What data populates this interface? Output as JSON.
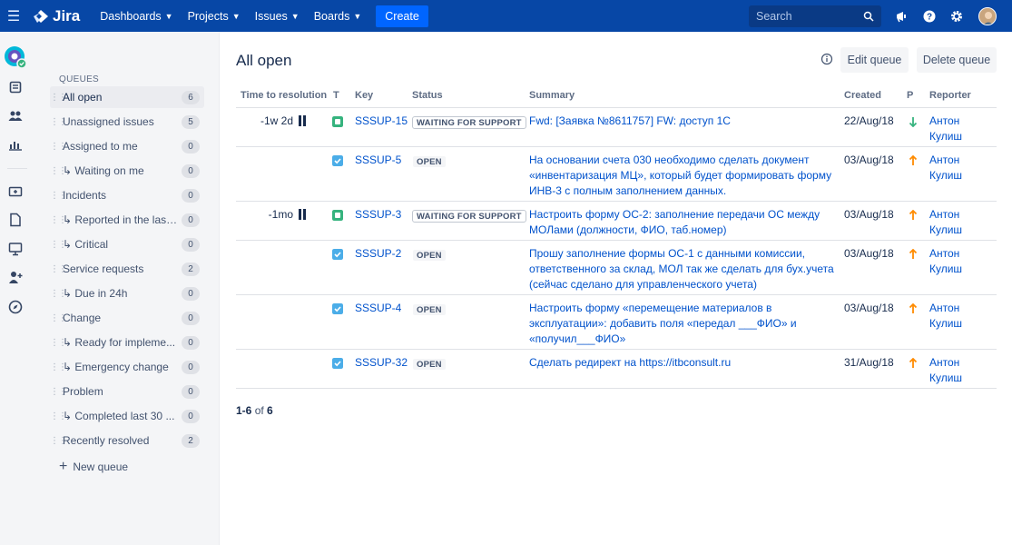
{
  "nav": {
    "brand": "Jira",
    "items": [
      {
        "label": "Dashboards"
      },
      {
        "label": "Projects"
      },
      {
        "label": "Issues"
      },
      {
        "label": "Boards"
      }
    ],
    "create_label": "Create",
    "search_placeholder": "Search",
    "icons": [
      "menu-icon",
      "jira-logo-icon",
      "search-icon",
      "notifications-icon",
      "help-icon",
      "settings-icon",
      "avatar"
    ]
  },
  "rail": {
    "icons": [
      "project-avatar",
      "queues-icon",
      "customers-icon",
      "reports-icon",
      "raise-request-icon",
      "knowledge-base-icon",
      "channels-icon",
      "invite-team-icon",
      "explore-icon"
    ]
  },
  "queues": {
    "title": "QUEUES",
    "items": [
      {
        "label": "All open",
        "count": "6"
      },
      {
        "label": "Unassigned issues",
        "count": "5"
      },
      {
        "label": "Assigned to me",
        "count": "0"
      },
      {
        "label": "↳ Waiting on me",
        "count": "0"
      },
      {
        "label": "Incidents",
        "count": "0"
      },
      {
        "label": "↳ Reported in the last...",
        "count": "0"
      },
      {
        "label": "↳ Critical",
        "count": "0"
      },
      {
        "label": "Service requests",
        "count": "2"
      },
      {
        "label": "↳ Due in 24h",
        "count": "0"
      },
      {
        "label": "Change",
        "count": "0"
      },
      {
        "label": "↳ Ready for impleme...",
        "count": "0"
      },
      {
        "label": "↳ Emergency change",
        "count": "0"
      },
      {
        "label": "Problem",
        "count": "0"
      },
      {
        "label": "↳ Completed last 30 ...",
        "count": "0"
      },
      {
        "label": "Recently resolved",
        "count": "2"
      }
    ],
    "new_queue_label": "New queue"
  },
  "main": {
    "title": "All open",
    "edit_queue_label": "Edit queue",
    "delete_queue_label": "Delete queue",
    "columns": [
      "Time to resolution",
      "T",
      "Key",
      "Status",
      "Summary",
      "Created",
      "P",
      "Reporter"
    ],
    "rows": [
      {
        "time": "-1w 2d",
        "paused": true,
        "type": "support",
        "key": "SSSUP-15",
        "status": "WAITING FOR SUPPORT",
        "summary": [
          "Fwd: [Заявка №8611757] FW: доступ 1С"
        ],
        "created": "22/Aug/18",
        "priority": "low",
        "reporter": [
          "Антон",
          "Кулиш"
        ]
      },
      {
        "time": "",
        "paused": false,
        "type": "task",
        "key": "SSSUP-5",
        "status": "OPEN",
        "summary": [
          "На основании счета 030 необходимо сделать документ",
          "«инвентаризация МЦ», который будет формировать форму",
          "ИНВ-3 с полным заполнением данных."
        ],
        "created": "03/Aug/18",
        "priority": "high",
        "reporter": [
          "Антон",
          "Кулиш"
        ]
      },
      {
        "time": "-1mo",
        "paused": true,
        "type": "support",
        "key": "SSSUP-3",
        "status": "WAITING FOR SUPPORT",
        "summary": [
          "Настроить форму ОС-2: заполнение передачи ОС между",
          "МОЛами (должности, ФИО, таб.номер)"
        ],
        "created": "03/Aug/18",
        "priority": "high",
        "reporter": [
          "Антон",
          "Кулиш"
        ]
      },
      {
        "time": "",
        "paused": false,
        "type": "task",
        "key": "SSSUP-2",
        "status": "OPEN",
        "summary": [
          "Прошу заполнение формы ОС-1 с данными комиссии,",
          "ответственного за склад, МОЛ так же сделать для бух.учета",
          "(сейчас сделано для управленческого учета)"
        ],
        "created": "03/Aug/18",
        "priority": "high",
        "reporter": [
          "Антон",
          "Кулиш"
        ]
      },
      {
        "time": "",
        "paused": false,
        "type": "task",
        "key": "SSSUP-4",
        "status": "OPEN",
        "summary": [
          "Настроить форму «перемещение материалов в",
          "эксплуатации»: добавить поля «передал ___ФИО» и",
          "«получил___ФИО»"
        ],
        "created": "03/Aug/18",
        "priority": "high",
        "reporter": [
          "Антон",
          "Кулиш"
        ]
      },
      {
        "time": "",
        "paused": false,
        "type": "task",
        "key": "SSSUP-32",
        "status": "OPEN",
        "summary": [
          "Сделать редирект на https://itbconsult.ru"
        ],
        "created": "31/Aug/18",
        "priority": "high",
        "reporter": [
          "Антон",
          "Кулиш"
        ]
      }
    ],
    "pager": {
      "range": "1-6",
      "of": "of",
      "total": "6"
    }
  },
  "colors": {
    "nav_bg": "#0747a6",
    "create_bg": "#0065ff",
    "link": "#0052cc",
    "priority_low": "#36b37e",
    "priority_high": "#ff8b00"
  }
}
